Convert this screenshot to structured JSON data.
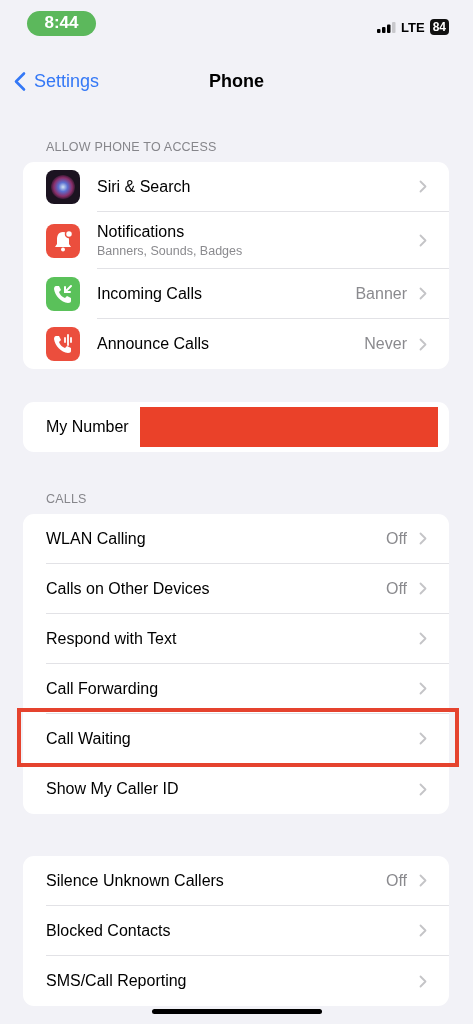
{
  "status_bar": {
    "time": "8:44",
    "network": "LTE",
    "battery": "84"
  },
  "nav": {
    "back": "Settings",
    "title": "Phone"
  },
  "sections": [
    {
      "header": "ALLOW PHONE TO ACCESS",
      "rows": [
        {
          "label": "Siri & Search",
          "kind": "siri"
        },
        {
          "label": "Notifications",
          "subtitle": "Banners, Sounds, Badges",
          "kind": "bell"
        },
        {
          "label": "Incoming Calls",
          "value": "Banner",
          "kind": "incoming"
        },
        {
          "label": "Announce Calls",
          "value": "Never",
          "kind": "announce"
        }
      ]
    },
    {
      "rows": [
        {
          "label": "My Number",
          "redacted": true
        }
      ]
    },
    {
      "header": "CALLS",
      "rows": [
        {
          "label": "WLAN Calling",
          "value": "Off"
        },
        {
          "label": "Calls on Other Devices",
          "value": "Off"
        },
        {
          "label": "Respond with Text"
        },
        {
          "label": "Call Forwarding"
        },
        {
          "label": "Call Waiting",
          "highlighted": true
        },
        {
          "label": "Show My Caller ID"
        }
      ]
    },
    {
      "rows": [
        {
          "label": "Silence Unknown Callers",
          "value": "Off"
        },
        {
          "label": "Blocked Contacts"
        },
        {
          "label": "SMS/Call Reporting"
        }
      ]
    }
  ]
}
